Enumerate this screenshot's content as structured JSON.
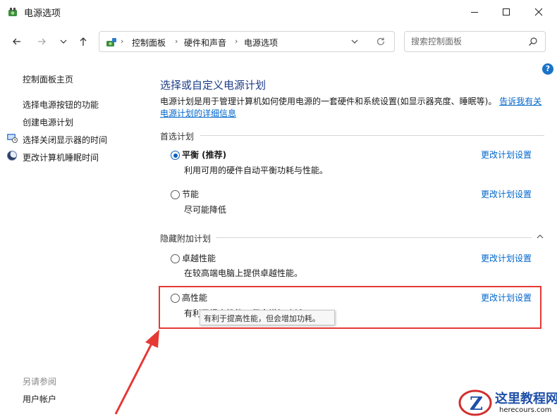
{
  "window": {
    "title": "电源选项",
    "controls": {
      "minimize": "minimize-icon",
      "maximize": "maximize-icon",
      "close": "close-icon"
    }
  },
  "nav": {
    "back": "arrow-left-icon",
    "forward": "arrow-right-icon",
    "recent": "chevron-down-icon",
    "up": "arrow-up-icon"
  },
  "address": {
    "breadcrumbs": [
      "控制面板",
      "硬件和声音",
      "电源选项"
    ],
    "separator": "›"
  },
  "search": {
    "placeholder": "搜索控制面板",
    "value": ""
  },
  "sidebar": {
    "home": "控制面板主页",
    "links": [
      {
        "label": "选择电源按钮的功能",
        "icon": ""
      },
      {
        "label": "创建电源计划",
        "icon": ""
      },
      {
        "label": "选择关闭显示器的时间",
        "icon": "monitor-clock-icon"
      },
      {
        "label": "更改计算机睡眠时间",
        "icon": "moon-icon"
      }
    ],
    "see_also": {
      "heading": "另请参阅",
      "links": [
        "用户帐户"
      ]
    }
  },
  "main": {
    "heading": "选择或自定义电源计划",
    "description": "电源计划是用于管理计算机如何使用电源的一套硬件和系统设置(如显示器亮度、睡眠等)。",
    "description_link": "告诉我有关电源计划的详细信息",
    "preferred_section": "首选计划",
    "hidden_section": "隐藏附加计划",
    "change_link": "更改计划设置",
    "plans": [
      {
        "name": "平衡 (推荐)",
        "desc": "利用可用的硬件自动平衡功耗与性能。",
        "selected": true
      },
      {
        "name": "节能",
        "desc": "尽可能降低",
        "selected": false
      },
      {
        "name": "卓越性能",
        "desc": "在较高端电脑上提供卓越性能。",
        "selected": false
      },
      {
        "name": "高性能",
        "desc": "有利于提高性能，但会增加功耗。",
        "selected": false
      }
    ],
    "tooltip": "有利于提高性能，但会增加功耗。"
  },
  "colors": {
    "annotation": "#e53935",
    "link": "#0066cc",
    "heading": "#1c3d87"
  },
  "watermark": {
    "title": "这里教程网",
    "url": "herecours.com"
  }
}
